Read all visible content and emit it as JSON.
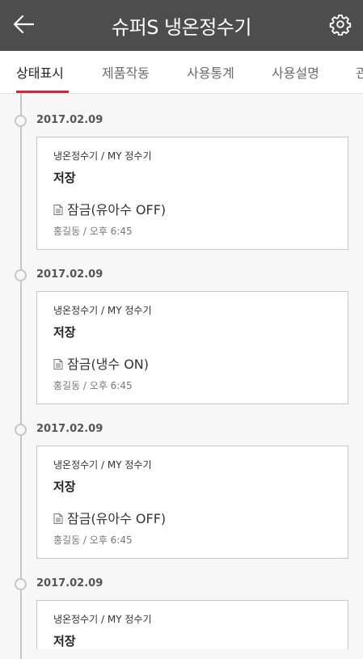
{
  "header": {
    "title": "슈퍼S 냉온정수기",
    "back_icon": "arrow-left-icon",
    "settings_icon": "gear-icon"
  },
  "tabs": [
    {
      "label": "상태표시",
      "active": true
    },
    {
      "label": "제품작동",
      "active": false
    },
    {
      "label": "사용통계",
      "active": false
    },
    {
      "label": "사용설명",
      "active": false
    },
    {
      "label": "관",
      "active": false
    }
  ],
  "entries": [
    {
      "date": "2017.02.09",
      "path": "냉온정수기 / MY 정수기",
      "title": "저장",
      "status": "잠금(유아수 OFF)",
      "meta": "홍길동 / 오후 6:45"
    },
    {
      "date": "2017.02.09",
      "path": "냉온정수기 / MY 정수기",
      "title": "저장",
      "status": "잠금(냉수 ON)",
      "meta": "홍길동 / 오후 6:45"
    },
    {
      "date": "2017.02.09",
      "path": "냉온정수기 / MY 정수기",
      "title": "저장",
      "status": "잠금(유아수 OFF)",
      "meta": "홍길동 / 오후 6:45"
    },
    {
      "date": "2017.02.09",
      "path": "냉온정수기 / MY 정수기",
      "title": "저장",
      "status": "",
      "meta": ""
    }
  ],
  "colors": {
    "header_bg": "#4d4d4d",
    "accent": "#c92a3c"
  }
}
